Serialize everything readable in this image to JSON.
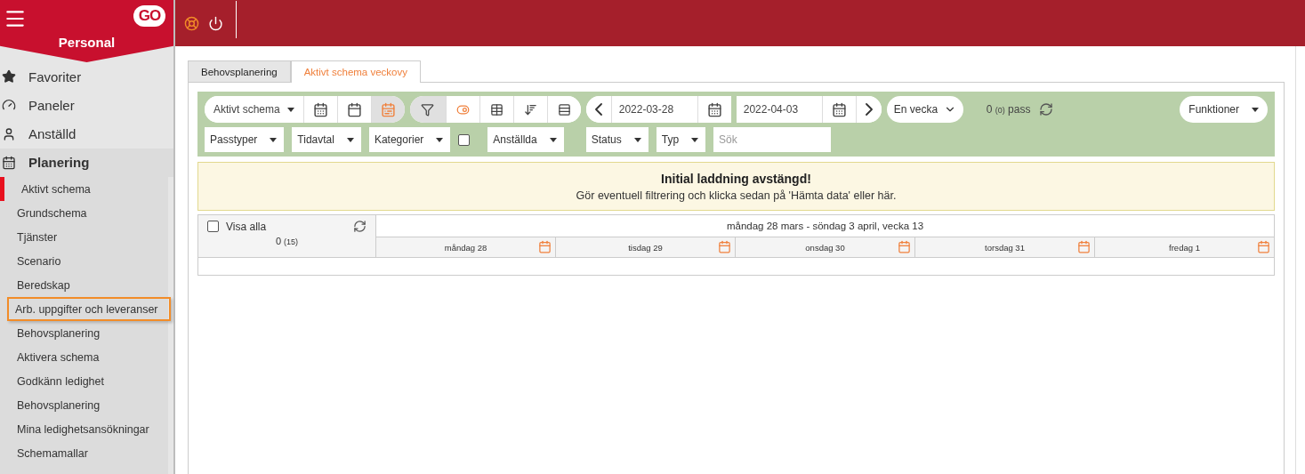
{
  "sidebar": {
    "logo": "GO",
    "title": "Personal",
    "items": [
      {
        "label": "Favoriter",
        "selected": false
      },
      {
        "label": "Paneler",
        "selected": false
      },
      {
        "label": "Anställd",
        "selected": false
      },
      {
        "label": "Planering",
        "selected": true,
        "expanded": true,
        "children": [
          {
            "label": "Aktivt schema",
            "selected": true,
            "focused": false
          },
          {
            "label": "Grundschema",
            "selected": false,
            "focused": false
          },
          {
            "label": "Tjänster",
            "selected": false,
            "focused": false
          },
          {
            "label": "Scenario",
            "selected": false,
            "focused": false
          },
          {
            "label": "Beredskap",
            "selected": false,
            "focused": false
          },
          {
            "label": "Arb. uppgifter och leveranser",
            "selected": false,
            "focused": true
          },
          {
            "label": "Behovsplanering",
            "selected": false,
            "focused": false
          },
          {
            "label": "Aktivera schema",
            "selected": false,
            "focused": false
          },
          {
            "label": "Godkänn ledighet",
            "selected": false,
            "focused": false
          },
          {
            "label": "Behovsplanering",
            "selected": false,
            "focused": false
          },
          {
            "label": "Mina ledighetsansökningar",
            "selected": false,
            "focused": false
          },
          {
            "label": "Schemamallar",
            "selected": false,
            "focused": false
          }
        ]
      }
    ]
  },
  "tabs": [
    {
      "label": "Behovsplanering",
      "selected": false
    },
    {
      "label": "Aktivt schema veckovy",
      "selected": true
    }
  ],
  "toolbar": {
    "schedule_select": "Aktivt schema",
    "view_buttons": [
      {
        "selected": false
      },
      {
        "selected": false
      },
      {
        "selected": true
      }
    ],
    "tool_buttons": [
      {
        "selected": true
      },
      {
        "selected": false
      },
      {
        "selected": false
      },
      {
        "selected": false
      },
      {
        "selected": false
      }
    ],
    "date_from": "2022-03-28",
    "date_to": "2022-04-03",
    "period": "En vecka",
    "count": "0",
    "count_sub": "(0)",
    "count_unit": "pass",
    "functions": "Funktioner",
    "filters": [
      {
        "kind": "dropdown",
        "label": "Passtyper"
      },
      {
        "kind": "dropdown",
        "label": "Tidavtal"
      },
      {
        "kind": "dropdown",
        "label": "Kategorier"
      },
      {
        "kind": "checkbox",
        "checked": false
      },
      {
        "kind": "dropdown",
        "label": "Anställda"
      },
      {
        "kind": "gap"
      },
      {
        "kind": "dropdown",
        "label": "Status"
      },
      {
        "kind": "dropdown",
        "label": "Typ"
      },
      {
        "kind": "search",
        "placeholder": "Sök"
      }
    ]
  },
  "notice": {
    "title": "Initial laddning avstängd!",
    "text": "Gör eventuell filtrering och klicka sedan på 'Hämta data' eller här."
  },
  "schedule": {
    "show_all": {
      "label": "Visa alla",
      "checked": false
    },
    "count": "0",
    "count_sub": "(15)",
    "week_title": "måndag 28 mars - söndag 3 april, vecka 13",
    "days": [
      "måndag 28",
      "tisdag 29",
      "onsdag 30",
      "torsdag 31",
      "fredag 1"
    ]
  }
}
